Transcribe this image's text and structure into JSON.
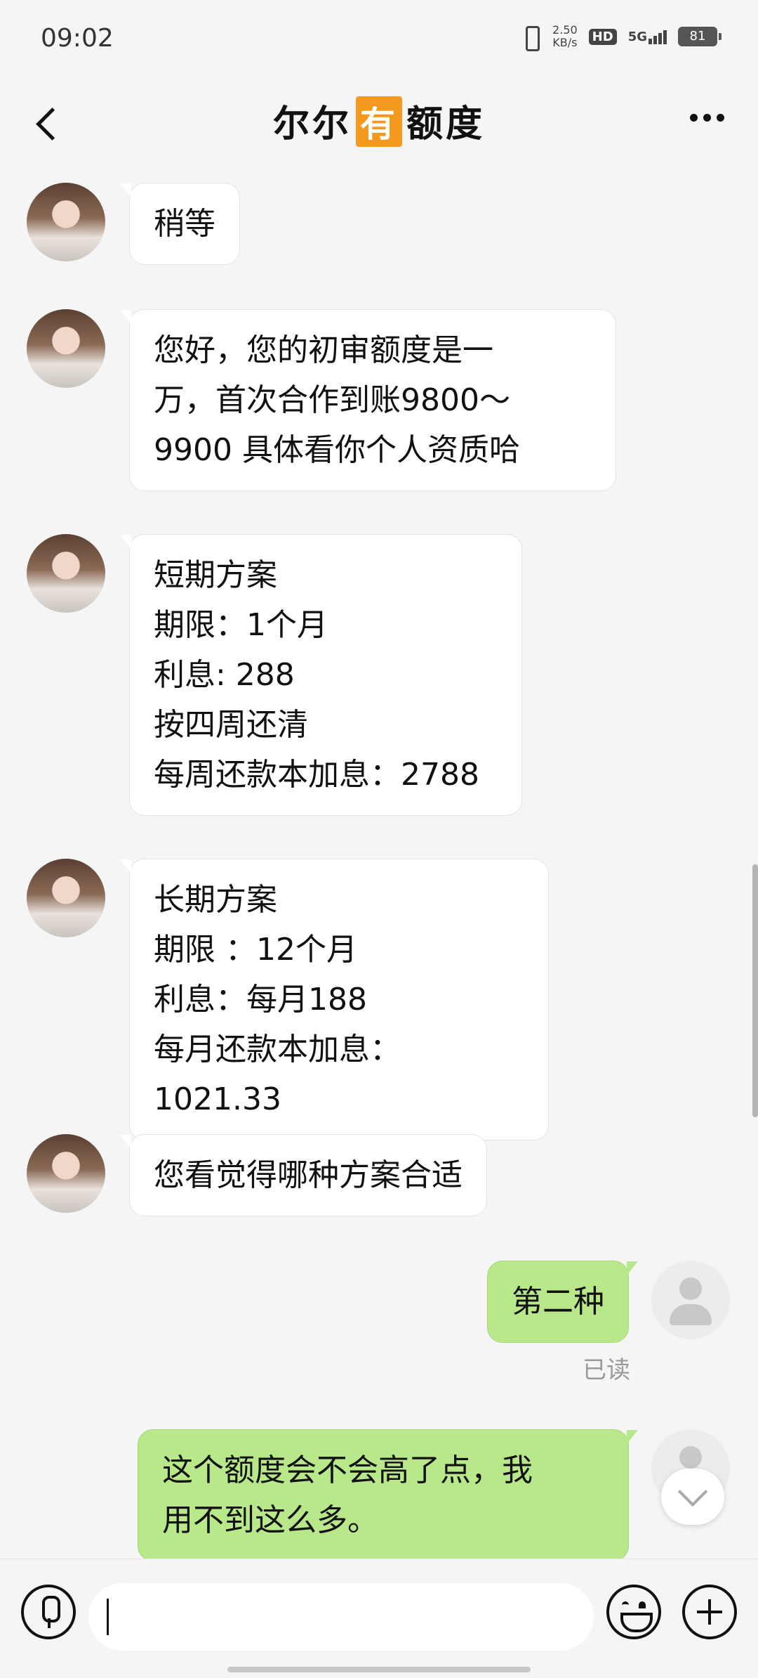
{
  "status_bar": {
    "time": "09:02",
    "net_speed": "2.50",
    "net_unit": "KB/s",
    "hd": "HD",
    "network": "5G",
    "battery": "81"
  },
  "header": {
    "title_a": "尔尔",
    "title_badge": "有",
    "title_b": "额度"
  },
  "messages": [
    {
      "from": "them",
      "text": "稍等"
    },
    {
      "from": "them",
      "text": "您好，您的初审额度是一\n万，首次合作到账9800～\n9900 具体看你个人资质哈"
    },
    {
      "from": "them",
      "text": "短期方案\n期限：1个月\n利息: 288\n按四周还清\n每周还款本加息：2788"
    },
    {
      "from": "them",
      "text": "长期方案\n期限 ：12个月\n利息：每月188\n每月还款本加息：1021.33"
    },
    {
      "from": "them",
      "text": "您看觉得哪种方案合适"
    },
    {
      "from": "me",
      "text": "第二种",
      "status": "已读"
    },
    {
      "from": "me",
      "text": "这个额度会不会高了点，我\n用不到这么多。"
    }
  ],
  "input": {
    "value": ""
  },
  "colors": {
    "accent_badge": "#f39a1e",
    "my_bubble": "#b8e88a",
    "their_bubble": "#ffffff",
    "background": "#f5f5f5"
  },
  "icons": [
    "back-icon",
    "more-icon",
    "voice-icon",
    "emoji-icon",
    "plus-icon",
    "scroll-down-icon"
  ]
}
